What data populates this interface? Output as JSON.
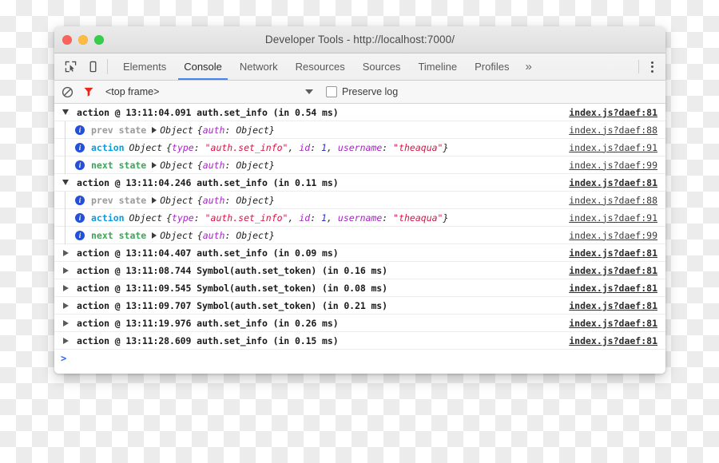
{
  "window": {
    "title": "Developer Tools - http://localhost:7000/",
    "traffic_lights": [
      "close-red",
      "minimize-yellow",
      "zoom-green"
    ]
  },
  "toolbar": {
    "inspect_icon": "inspect-element-icon",
    "device_icon": "device-toolbar-icon",
    "menu_icon": "vertical-dots-menu-icon",
    "tabs": [
      {
        "label": "Elements",
        "active": false
      },
      {
        "label": "Console",
        "active": true
      },
      {
        "label": "Network",
        "active": false
      },
      {
        "label": "Resources",
        "active": false
      },
      {
        "label": "Sources",
        "active": false
      },
      {
        "label": "Timeline",
        "active": false
      },
      {
        "label": "Profiles",
        "active": false
      }
    ],
    "more_tabs_label": "»",
    "active_tab_color": "#4285f4"
  },
  "filterbar": {
    "clear_icon": "clear-console-icon",
    "filter_icon": "filter-funnel-icon",
    "filter_icon_color": "#e8271e",
    "frame_value": "<top frame>",
    "dropdown_icon": "chevron-down-icon",
    "preserve_log_label": "Preserve log",
    "preserve_log_checked": false
  },
  "console": {
    "prompt": ">",
    "groups": [
      {
        "expanded": true,
        "header": "action @ 13:11:04.091 auth.set_info (in 0.54 ms)",
        "link": "index.js?daef:81",
        "children": [
          {
            "label": "prev state",
            "label_kind": "prev",
            "obj": "Object",
            "body": "{auth: Object}",
            "link": "index.js?daef:88"
          },
          {
            "label": "action",
            "label_kind": "action",
            "obj": "Object",
            "body": "{type: \"auth.set_info\", id: 1, username: \"theaqua\"}",
            "link": "index.js?daef:91"
          },
          {
            "label": "next state",
            "label_kind": "next",
            "obj": "Object",
            "body": "{auth: Object}",
            "link": "index.js?daef:99"
          }
        ]
      },
      {
        "expanded": true,
        "header": "action @ 13:11:04.246 auth.set_info (in 0.11 ms)",
        "link": "index.js?daef:81",
        "children": [
          {
            "label": "prev state",
            "label_kind": "prev",
            "obj": "Object",
            "body": "{auth: Object}",
            "link": "index.js?daef:88"
          },
          {
            "label": "action",
            "label_kind": "action",
            "obj": "Object",
            "body": "{type: \"auth.set_info\", id: 1, username: \"theaqua\"}",
            "link": "index.js?daef:91"
          },
          {
            "label": "next state",
            "label_kind": "next",
            "obj": "Object",
            "body": "{auth: Object}",
            "link": "index.js?daef:99"
          }
        ]
      },
      {
        "expanded": false,
        "header": "action @ 13:11:04.407 auth.set_info (in 0.09 ms)",
        "link": "index.js?daef:81"
      },
      {
        "expanded": false,
        "header": "action @ 13:11:08.744 Symbol(auth.set_token) (in 0.16 ms)",
        "link": "index.js?daef:81"
      },
      {
        "expanded": false,
        "header": "action @ 13:11:09.545 Symbol(auth.set_token) (in 0.08 ms)",
        "link": "index.js?daef:81"
      },
      {
        "expanded": false,
        "header": "action @ 13:11:09.707 Symbol(auth.set_token) (in 0.21 ms)",
        "link": "index.js?daef:81"
      },
      {
        "expanded": false,
        "header": "action @ 13:11:19.976 auth.set_info (in 0.26 ms)",
        "link": "index.js?daef:81"
      },
      {
        "expanded": false,
        "header": "action @ 13:11:28.609 auth.set_info (in 0.15 ms)",
        "link": "index.js?daef:81"
      }
    ]
  },
  "colors": {
    "accent": "#4285f4",
    "info_badge": "#2250d8",
    "label_action": "#00a0e4",
    "label_next": "#3aa757",
    "label_prev": "#9a9a9a",
    "string": "#dd1144",
    "key": "#aa22c8",
    "number": "#2a31d6"
  }
}
